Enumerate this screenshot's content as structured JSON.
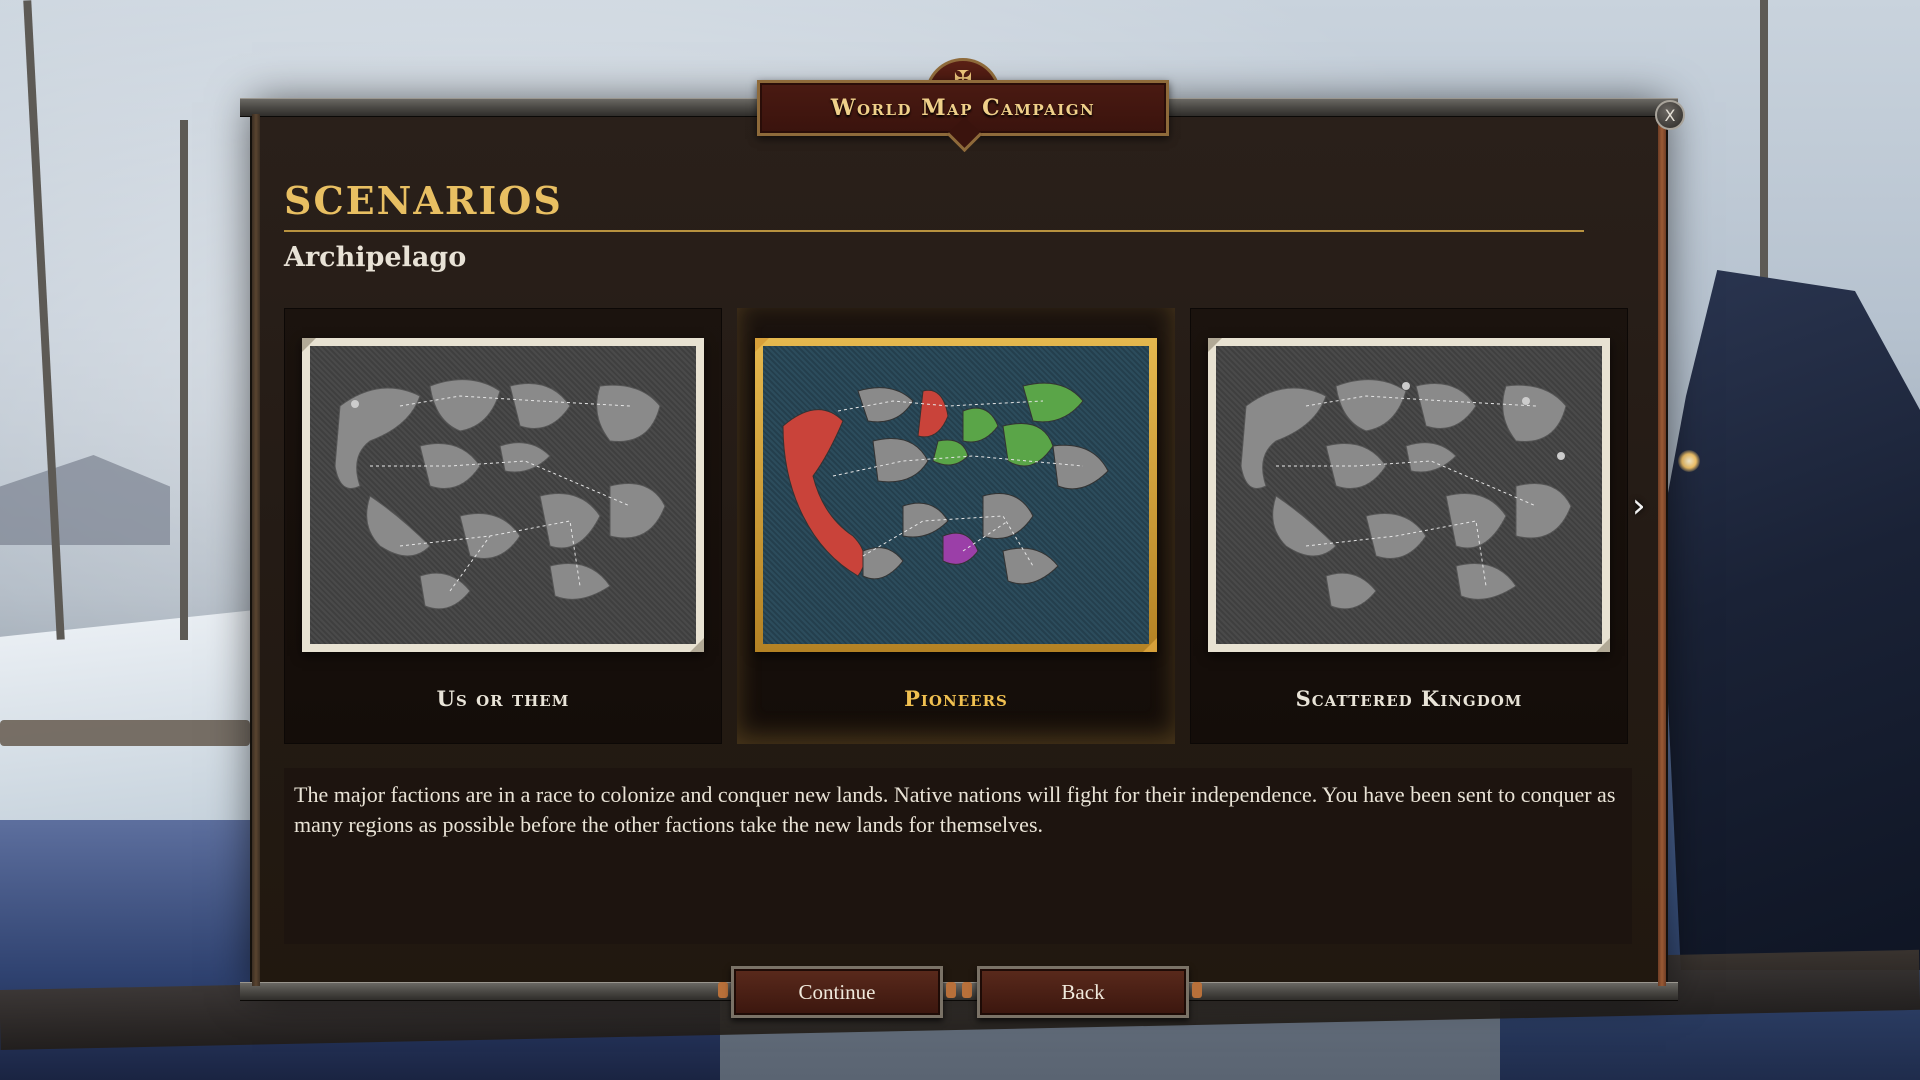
{
  "window": {
    "title": "World Map Campaign",
    "close_label": "X"
  },
  "section": {
    "heading": "SCENARIOS",
    "subheading": "Archipelago"
  },
  "scenarios": [
    {
      "label": "Us or them",
      "selected": false
    },
    {
      "label": "Pioneers",
      "selected": true
    },
    {
      "label": "Scattered Kingdom",
      "selected": false
    }
  ],
  "description": "The major factions are in a race to colonize and conquer new lands. Native nations will fight for their independence. You have been sent to conquer as many regions as possible before the other factions take the new lands for themselves.",
  "buttons": {
    "continue": "Continue",
    "back": "Back"
  },
  "icons": {
    "next": "chevron-right-icon",
    "close": "close-icon",
    "crest": "cross-crest-icon"
  },
  "colors": {
    "accent_gold": "#e8bf62",
    "faction_red": "#c9433a",
    "faction_green": "#5aa548",
    "faction_purple": "#9b3fa8"
  }
}
